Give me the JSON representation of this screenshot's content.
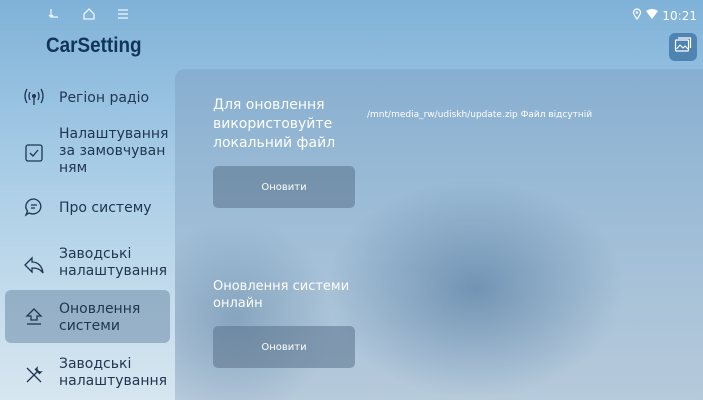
{
  "status": {
    "time": "10:21",
    "icons": [
      "back-icon",
      "home-icon",
      "menu-icon",
      "location-icon",
      "wifi-icon"
    ]
  },
  "app": {
    "title": "CarSetting"
  },
  "sidebar": {
    "items": [
      {
        "label": "Регіон радіо",
        "icon": "radio-signal-icon",
        "active": false
      },
      {
        "label": "Налаштування за замовчуванням",
        "label_lines": [
          "Налаштування",
          "за замовчуван",
          "ням"
        ],
        "icon": "checkbox-icon",
        "active": false
      },
      {
        "label": "Про систему",
        "icon": "info-bubble-icon",
        "active": false
      },
      {
        "label_lines": [
          "Заводські",
          "налаштування"
        ],
        "icon": "return-arrow-icon",
        "active": false
      },
      {
        "label_lines": [
          "Оновлення",
          "системи"
        ],
        "icon": "upload-icon",
        "active": true
      },
      {
        "label_lines": [
          "Заводські",
          "налаштування"
        ],
        "icon": "tools-icon",
        "active": false
      }
    ]
  },
  "main": {
    "local": {
      "lines": [
        "Для оновлення",
        "використовуйте",
        "локальний файл"
      ],
      "path_status": "/mnt/media_rw/udiskh/update.zip Файл відсутній",
      "button_label": "Оновити"
    },
    "online": {
      "lines": [
        "Оновлення системи",
        "онлайн"
      ],
      "button_label": "Оновити"
    }
  }
}
